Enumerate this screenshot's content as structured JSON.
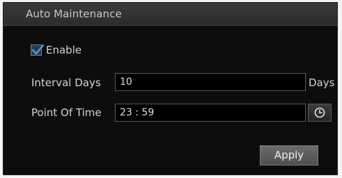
{
  "panel": {
    "title": "Auto Maintenance"
  },
  "enable": {
    "label": "Enable",
    "checked": true
  },
  "interval_days": {
    "label": "Interval Days",
    "value": "10",
    "unit": "Days"
  },
  "point_of_time": {
    "label": "Point Of Time",
    "value": "23 : 59",
    "picker_icon": "clock-icon"
  },
  "actions": {
    "apply_label": "Apply"
  },
  "colors": {
    "panel_background": "#0d0d0d",
    "header_background": "#333333",
    "checkbox_check": "#4a9fd8",
    "button_background": "#5e5e5e"
  }
}
